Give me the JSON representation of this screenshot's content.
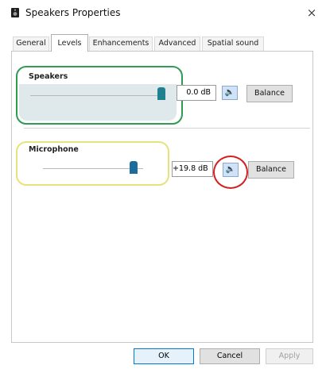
{
  "window": {
    "title": "Speakers Properties",
    "close_glyph": "×",
    "icon": "speaker-properties-icon"
  },
  "tabs": [
    {
      "label": "General",
      "active": false
    },
    {
      "label": "Levels",
      "active": true
    },
    {
      "label": "Enhancements",
      "active": false
    },
    {
      "label": "Advanced",
      "active": false
    },
    {
      "label": "Spatial sound",
      "active": false
    }
  ],
  "levels": {
    "speakers": {
      "label": "Speakers",
      "value": "0.0 dB",
      "mute_icon": "speaker-icon",
      "balance_label": "Balance",
      "level": 1.0
    },
    "microphone": {
      "label": "Microphone",
      "value": "+19.8 dB",
      "mute_icon": "speaker-icon",
      "balance_label": "Balance",
      "level": 1.0
    }
  },
  "buttons": {
    "ok": "OK",
    "cancel": "Cancel",
    "apply": "Apply"
  },
  "colors": {
    "speakers_highlight": "#2e9c52",
    "microphone_highlight": "#e8e27a",
    "mute_highlight": "#d42020"
  }
}
